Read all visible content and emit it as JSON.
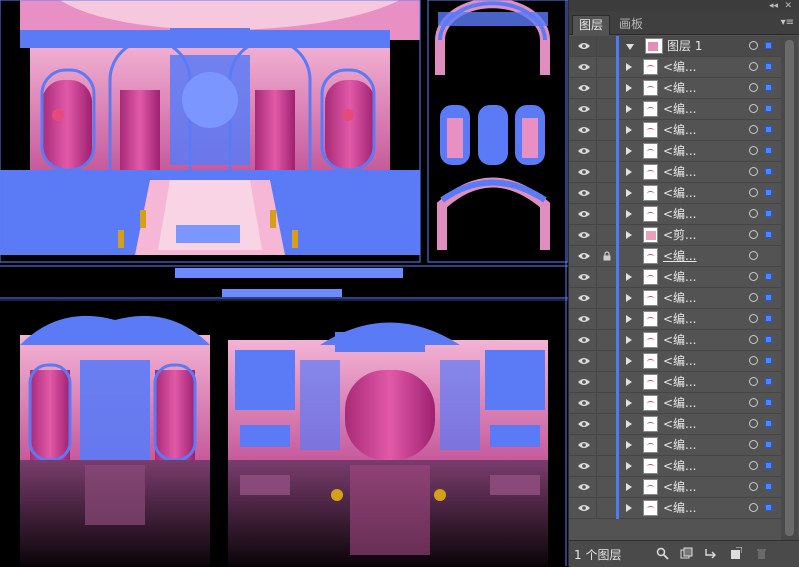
{
  "panel": {
    "tabs": [
      {
        "label": "图层"
      },
      {
        "label": "画板"
      }
    ],
    "layer_count_label": "1 个图层",
    "top_layer": {
      "name": "图层 1"
    },
    "rows": [
      {
        "label": "<编..."
      },
      {
        "label": "<编..."
      },
      {
        "label": "<编..."
      },
      {
        "label": "<编..."
      },
      {
        "label": "<编..."
      },
      {
        "label": "<编..."
      },
      {
        "label": "<编..."
      },
      {
        "label": "<编..."
      },
      {
        "label": "<剪..."
      },
      {
        "label": "<编..."
      },
      {
        "label": "<编..."
      },
      {
        "label": "<编..."
      },
      {
        "label": "<编..."
      },
      {
        "label": "<编..."
      },
      {
        "label": "<编..."
      },
      {
        "label": "<编..."
      },
      {
        "label": "<编..."
      },
      {
        "label": "<编..."
      },
      {
        "label": "<编..."
      },
      {
        "label": "<编..."
      },
      {
        "label": "<编..."
      },
      {
        "label": "<编..."
      }
    ]
  },
  "icons": {
    "eye": "eye-icon",
    "lock": "lock-icon",
    "expand": "expand-triangle-icon",
    "target": "target-circle-icon",
    "search": "search-icon",
    "new_layer": "new-layer-icon",
    "delete": "trash-icon"
  },
  "colors": {
    "accent": "#4c7cf0",
    "artwork_blue": "#5b7bf6",
    "artwork_pink": "#e98fc0"
  }
}
